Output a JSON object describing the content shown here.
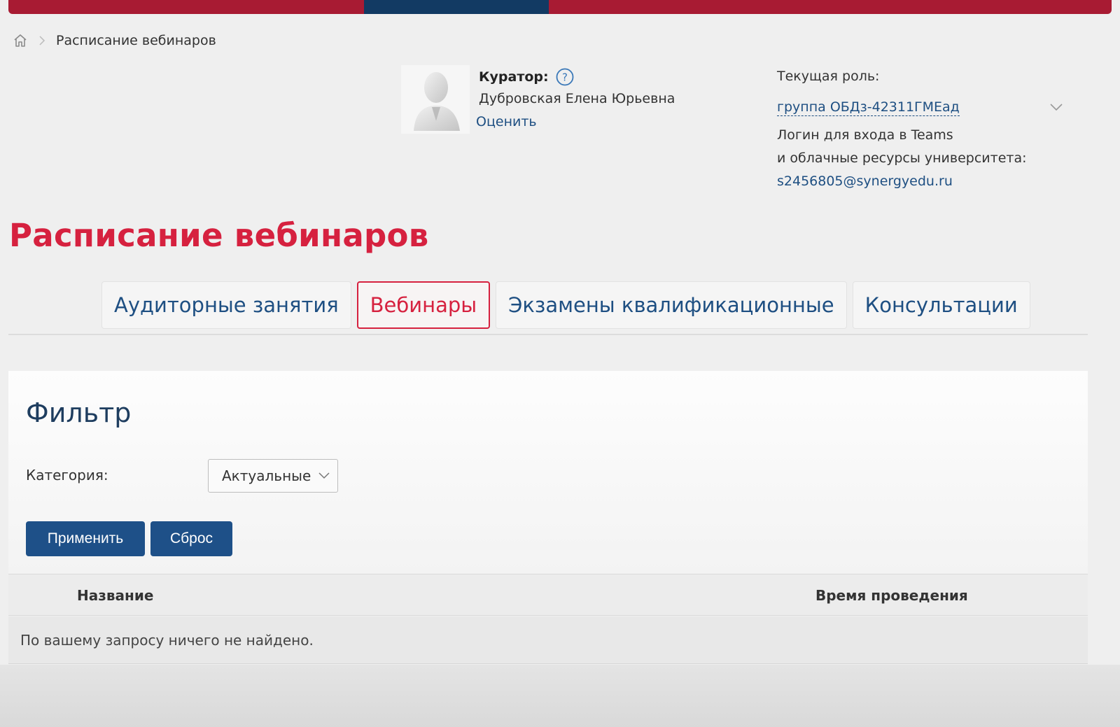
{
  "colors": {
    "brand_red": "#d6213f",
    "nav_bar": "#a81b33",
    "nav_active": "#123a63",
    "link_blue": "#1e4f82",
    "button_blue": "#1e5088"
  },
  "breadcrumb": {
    "home_icon": "home-icon",
    "current": "Расписание вебинаров"
  },
  "curator": {
    "label": "Куратор:",
    "help_icon": "question-circle-icon",
    "name": "Дубровская Елена Юрьевна",
    "rate_link": "Оценить"
  },
  "role": {
    "title": "Текущая роль:",
    "selected": "группа ОБДз-42311ГМЕад",
    "login_line1": "Логин для входа в Teams",
    "login_line2": "и облачные ресурсы университета:",
    "email": "s2456805@synergyedu.ru"
  },
  "page_title": "Расписание вебинаров",
  "tabs": [
    {
      "label": "Аудиторные занятия",
      "active": false
    },
    {
      "label": "Вебинары",
      "active": true
    },
    {
      "label": "Экзамены квалификационные",
      "active": false
    },
    {
      "label": "Консультации",
      "active": false
    }
  ],
  "filter": {
    "title": "Фильтр",
    "category_label": "Категория:",
    "category_value": "Актуальные",
    "apply_label": "Применить",
    "reset_label": "Сброс"
  },
  "table": {
    "columns": [
      "Название",
      "Время проведения"
    ],
    "empty_message": "По вашему запросу ничего не найдено."
  }
}
